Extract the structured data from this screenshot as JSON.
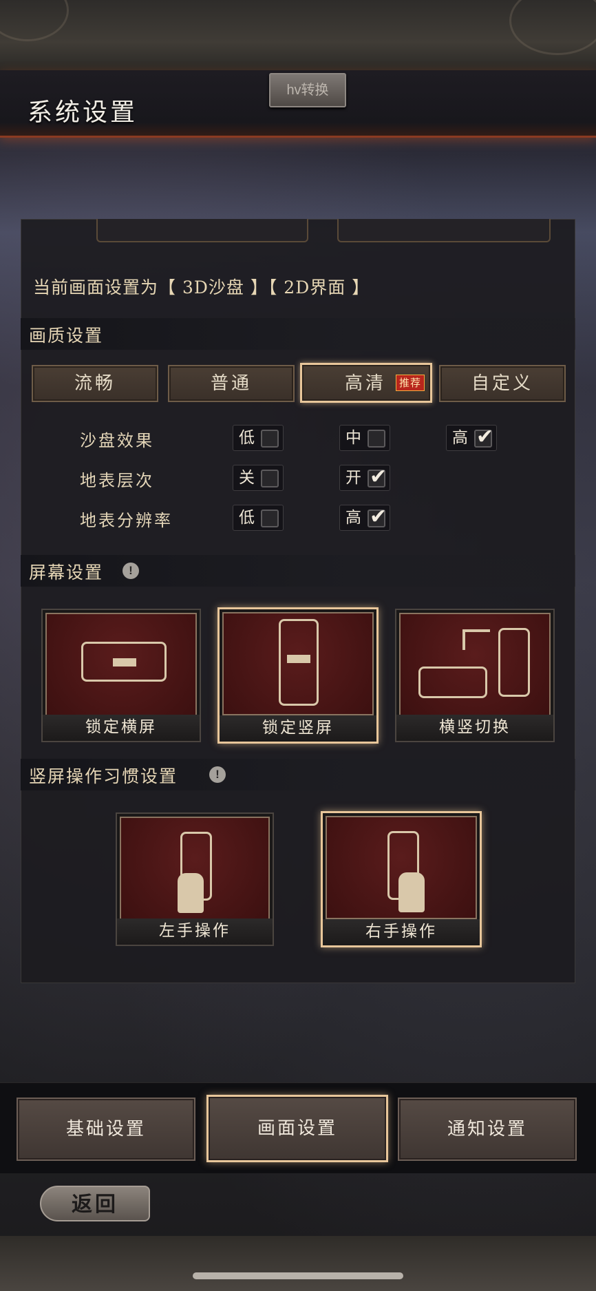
{
  "header": {
    "title": "系统设置",
    "hv_button": "hv转换"
  },
  "current_setting": "当前画面设置为【 3D沙盘 】【 2D界面 】",
  "quality": {
    "section_title": "画质设置",
    "presets": [
      {
        "label": "流畅",
        "selected": false
      },
      {
        "label": "普通",
        "selected": false
      },
      {
        "label": "高清",
        "selected": true,
        "badge": "推荐"
      },
      {
        "label": "自定义",
        "selected": false
      }
    ],
    "options": [
      {
        "label": "沙盘效果",
        "choices": [
          {
            "label": "低",
            "checked": false
          },
          {
            "label": "中",
            "checked": false
          },
          {
            "label": "高",
            "checked": true
          }
        ]
      },
      {
        "label": "地表层次",
        "choices": [
          {
            "label": "关",
            "checked": false
          },
          {
            "label": "开",
            "checked": true
          }
        ]
      },
      {
        "label": "地表分辨率",
        "choices": [
          {
            "label": "低",
            "checked": false
          },
          {
            "label": "高",
            "checked": true
          }
        ]
      }
    ]
  },
  "screen": {
    "section_title": "屏幕设置",
    "cards": [
      {
        "label": "锁定横屏",
        "selected": false
      },
      {
        "label": "锁定竖屏",
        "selected": true
      },
      {
        "label": "横竖切换",
        "selected": false
      }
    ]
  },
  "habit": {
    "section_title": "竖屏操作习惯设置",
    "cards": [
      {
        "label": "左手操作",
        "selected": false
      },
      {
        "label": "右手操作",
        "selected": true
      }
    ]
  },
  "bottom_nav": [
    {
      "label": "基础设置",
      "selected": false
    },
    {
      "label": "画面设置",
      "selected": true
    },
    {
      "label": "通知设置",
      "selected": false
    }
  ],
  "back_button": "返回",
  "icons": {
    "info": "info-icon",
    "check": "check-icon"
  },
  "colors": {
    "accent_border": "#e8c69a",
    "badge_red": "#b8261c",
    "title_glow": "#8a3a22"
  }
}
